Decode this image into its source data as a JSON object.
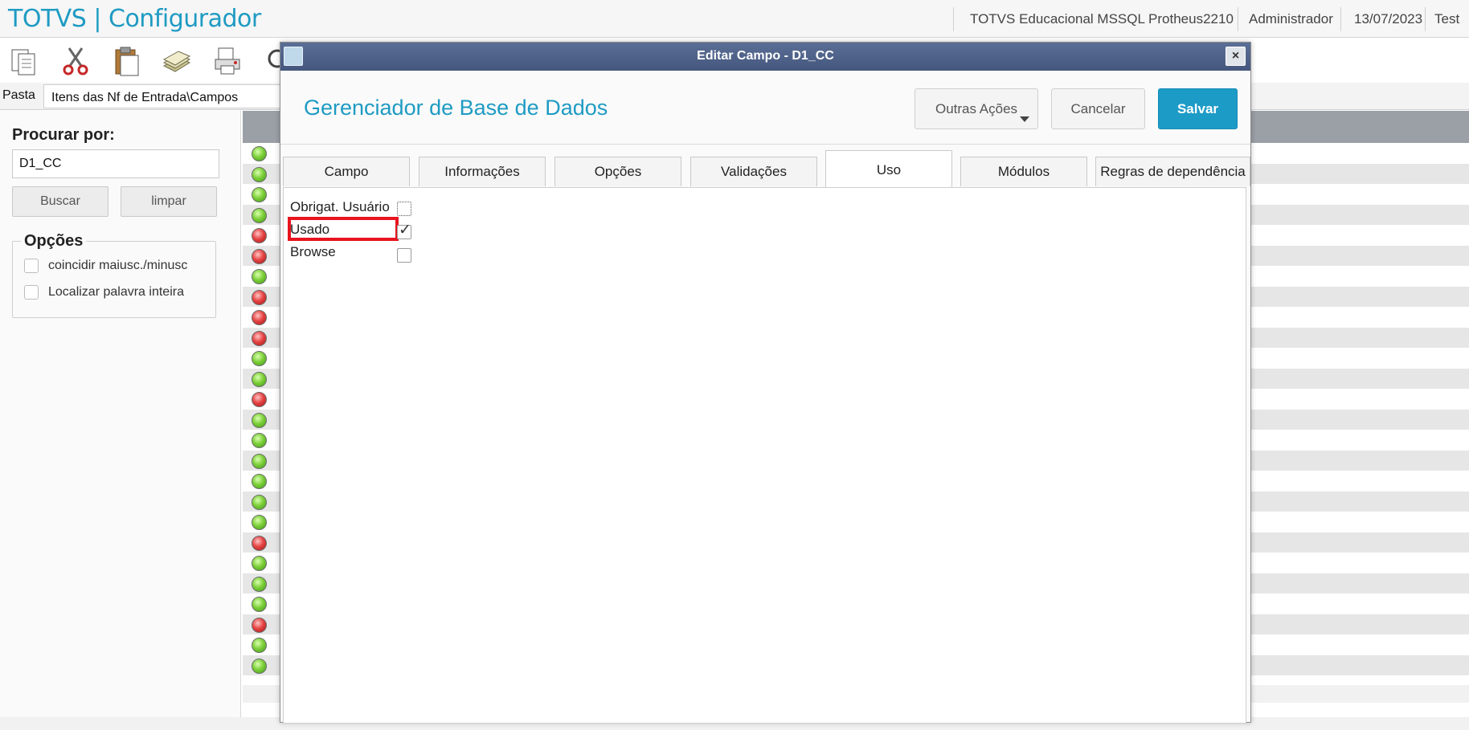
{
  "header": {
    "app_title": "TOTVS | Configurador",
    "environment": "TOTVS Educacional MSSQL Protheus2210",
    "user": "Administrador",
    "date": "13/07/2023",
    "extra": "Test"
  },
  "toolbar": {
    "icons": [
      "copy-icon",
      "cut-icon",
      "paste-icon",
      "database-icon",
      "print-icon",
      "search-icon"
    ]
  },
  "breadcrumb": {
    "label": "Pasta",
    "path": "Itens das Nf de Entrada\\Campos"
  },
  "search_panel": {
    "title": "Procurar por:",
    "query": "D1_CC",
    "search_button": "Buscar",
    "clear_button": "limpar",
    "options_title": "Opções",
    "options": [
      {
        "label": "coincidir maiusc./minusc",
        "checked": false
      },
      {
        "label": "Localizar palavra inteira",
        "checked": false
      }
    ]
  },
  "grid": {
    "row_status": [
      "ok",
      "ok",
      "ok",
      "ok",
      "err",
      "err",
      "ok",
      "err",
      "err",
      "err",
      "ok",
      "ok",
      "err",
      "ok",
      "ok",
      "ok",
      "ok",
      "ok",
      "ok",
      "err",
      "ok",
      "ok",
      "ok",
      "err",
      "ok",
      "ok"
    ],
    "colors": {
      "ok": "#6cc62e",
      "err": "#e23b3b",
      "header": "#9aa0a6"
    }
  },
  "modal": {
    "title": "Editar Campo - D1_CC",
    "close_glyph": "×",
    "heading": "Gerenciador de Base de Dados",
    "buttons": {
      "more_actions": "Outras Ações",
      "cancel": "Cancelar",
      "save": "Salvar"
    },
    "tabs": [
      {
        "label": "Campo",
        "active": false
      },
      {
        "label": "Informações",
        "active": false
      },
      {
        "label": "Opções",
        "active": false
      },
      {
        "label": "Validações",
        "active": false
      },
      {
        "label": "Uso",
        "active": true
      },
      {
        "label": "Módulos",
        "active": false
      },
      {
        "label": "Regras de dependência",
        "active": false
      }
    ],
    "fields": [
      {
        "label": "Obrigat. Usuário",
        "checked": false
      },
      {
        "label": "Usado",
        "checked": true
      },
      {
        "label": "Browse",
        "checked": false
      }
    ],
    "accent_color": "#1d9bc7",
    "highlight_color": "#e8131e"
  }
}
